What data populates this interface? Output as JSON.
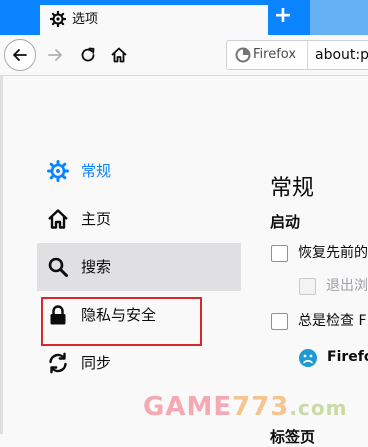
{
  "tabstrip": {
    "tab_title": "选项",
    "tab_close": "×",
    "new_tab": "+"
  },
  "navbar": {
    "identity_label": "Firefox",
    "url": "about:pr"
  },
  "sidebar": {
    "items": [
      {
        "label": "常规",
        "icon": "gear-icon",
        "active": true
      },
      {
        "label": "主页",
        "icon": "home-icon"
      },
      {
        "label": "搜索",
        "icon": "search-icon",
        "hovered": true
      },
      {
        "label": "隐私与安全",
        "icon": "lock-icon",
        "highlighted": true
      },
      {
        "label": "同步",
        "icon": "sync-icon"
      }
    ]
  },
  "main": {
    "heading": "常规",
    "startup": {
      "heading": "启动",
      "restore_session": "恢复先前的",
      "warn_on_quit": "退出浏",
      "always_check": "总是检查 F",
      "default_status": "Firefox"
    },
    "next_section": "标签页"
  },
  "watermark": {
    "text_a": "GAME",
    "text_b": "773",
    "text_c": ".com"
  },
  "colors": {
    "accent": "#0a84ff",
    "highlight_box": "#d6282d"
  }
}
